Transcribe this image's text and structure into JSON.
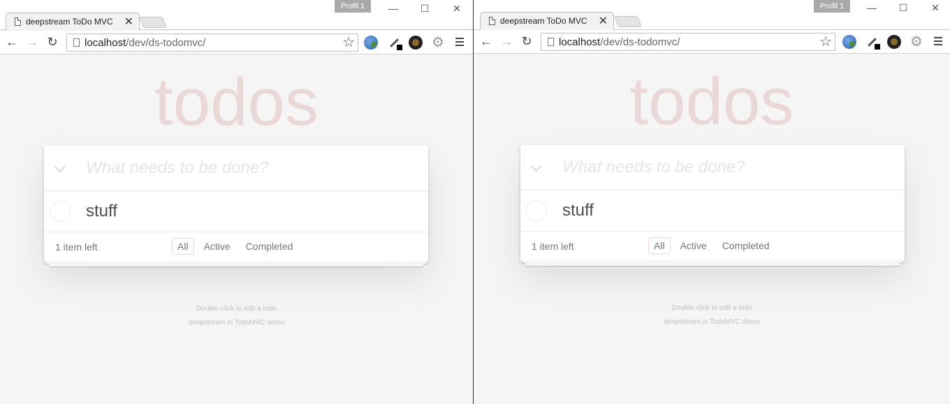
{
  "browser": {
    "tab_title": "deepstream ToDo MVC",
    "tab_close": "✕",
    "profile_label": "Profil 1",
    "url_host": "localhost",
    "url_path": "/dev/ds-todomvc/",
    "window_controls": {
      "minimize": "—",
      "maximize": "☐",
      "close": "✕"
    },
    "nav": {
      "back": "←",
      "forward": "→",
      "reload": "↻"
    },
    "bookmark_star": "☆",
    "extension_icons": [
      "globe-extension-icon",
      "eyedropper-extension-icon",
      "camera-extension-icon",
      "react-gear-extension-icon"
    ]
  },
  "app": {
    "heading": "todos",
    "new_todo_placeholder": "What needs to be done?",
    "todos": [
      {
        "label": "stuff",
        "completed": false
      }
    ],
    "items_left": "1 item left",
    "filters": [
      {
        "label": "All",
        "selected": true
      },
      {
        "label": "Active",
        "selected": false
      },
      {
        "label": "Completed",
        "selected": false
      }
    ],
    "info_line1": "Double-click to edit a todo",
    "info_line2": "deepstream.io TodoMVC demo"
  }
}
